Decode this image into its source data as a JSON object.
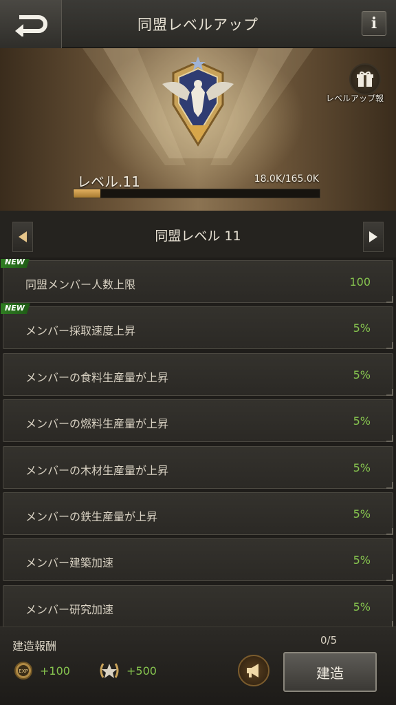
{
  "header": {
    "title": "同盟レベルアップ",
    "info_label": "i"
  },
  "banner": {
    "gift_label": "レベルアップ報",
    "level_label": "レベル.11",
    "exp_text": "18.0K/165.0K",
    "exp_progress": 0.109
  },
  "selector": {
    "level_name": "同盟レベル 11"
  },
  "perks": [
    {
      "name": "同盟メンバー人数上限",
      "value": "100",
      "new": true,
      "badge": "NEW"
    },
    {
      "name": "メンバー採取速度上昇",
      "value": "5%",
      "new": true,
      "badge": "NEW"
    },
    {
      "name": "メンバーの食料生産量が上昇",
      "value": "5%",
      "new": false
    },
    {
      "name": "メンバーの燃料生産量が上昇",
      "value": "5%",
      "new": false
    },
    {
      "name": "メンバーの木材生産量が上昇",
      "value": "5%",
      "new": false
    },
    {
      "name": "メンバーの鉄生産量が上昇",
      "value": "5%",
      "new": false
    },
    {
      "name": "メンバー建築加速",
      "value": "5%",
      "new": false
    },
    {
      "name": "メンバー研究加速",
      "value": "5%",
      "new": false
    }
  ],
  "footer": {
    "reward_title": "建造報酬",
    "exp_reward": "+100",
    "honor_reward": "+500",
    "progress_count": "0/5",
    "build_label": "建造",
    "exp_icon_text": "EXP"
  },
  "colors": {
    "accent_green": "#86c44f",
    "gold": "#c9a35a"
  }
}
